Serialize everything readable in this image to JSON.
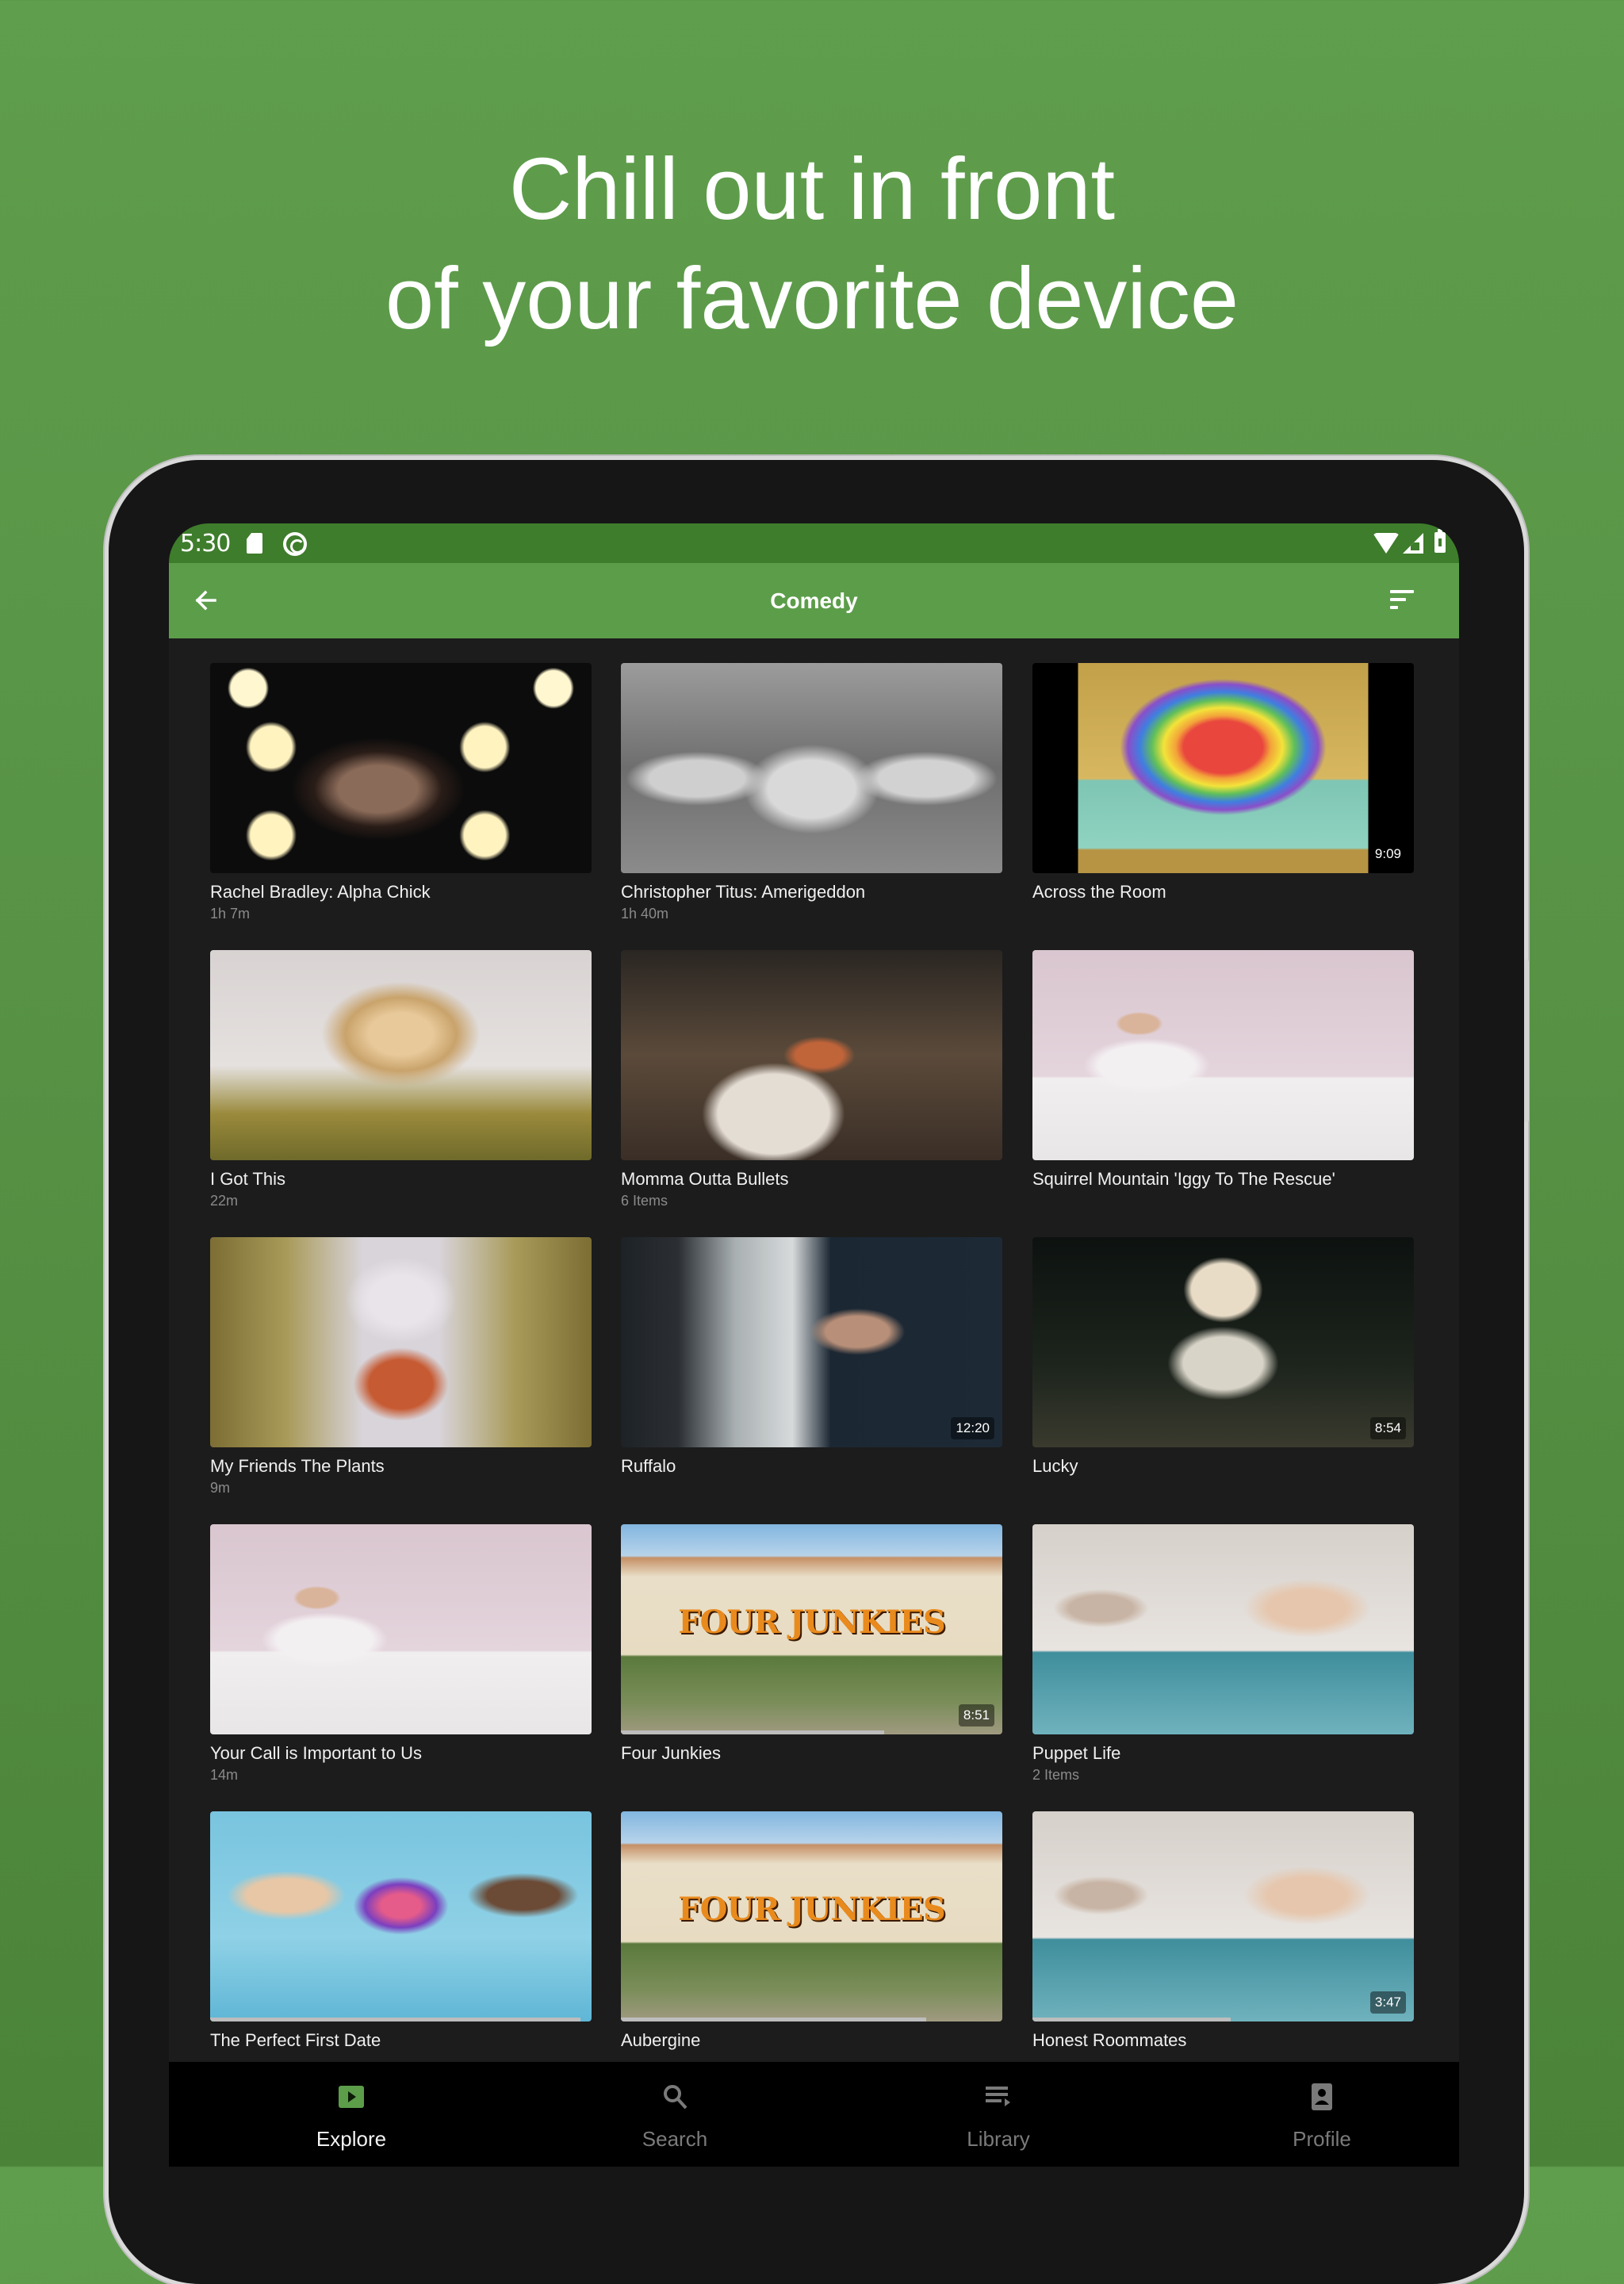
{
  "headline": {
    "line1": "Chill out in front",
    "line2": "of your favorite device"
  },
  "colors": {
    "brand_green": "#5c9d4a",
    "status_green": "#3e7d2b",
    "background": "#1c1c1c"
  },
  "statusbar": {
    "time": "5:30",
    "icons": [
      "sd-card-icon",
      "sync-icon",
      "wifi-icon",
      "signal-icon",
      "battery-charging-icon"
    ]
  },
  "appbar": {
    "back_icon": "arrow-back-icon",
    "title": "Comedy",
    "sort_icon": "sort-icon"
  },
  "items": [
    {
      "title": "Rachel Bradley: Alpha Chick",
      "subtitle": "1h 7m",
      "duration": "",
      "progress": null,
      "thumb": "stage-lights"
    },
    {
      "title": "Christopher Titus: Amerigeddon",
      "subtitle": "1h 40m",
      "duration": "",
      "progress": null,
      "thumb": "bw-couch"
    },
    {
      "title": "Across the Room",
      "subtitle": "",
      "duration": "9:09",
      "progress": null,
      "thumb": "rainbow-poster"
    },
    {
      "title": "I Got This",
      "subtitle": "22m",
      "duration": "",
      "progress": null,
      "thumb": "blonde-woman"
    },
    {
      "title": "Momma Outta Bullets",
      "subtitle": "6 Items",
      "duration": "",
      "progress": null,
      "thumb": "night-cafe"
    },
    {
      "title": "Squirrel Mountain 'Iggy To The Rescue'",
      "subtitle": "",
      "duration": "",
      "progress": null,
      "thumb": "office-cheer"
    },
    {
      "title": "My Friends The Plants",
      "subtitle": "9m",
      "duration": "",
      "progress": null,
      "thumb": "plants-room"
    },
    {
      "title": "Ruffalo",
      "subtitle": "",
      "duration": "12:20",
      "progress": null,
      "thumb": "doorway-man"
    },
    {
      "title": "Lucky",
      "subtitle": "",
      "duration": "8:54",
      "progress": null,
      "thumb": "night-table"
    },
    {
      "title": "Your Call is Important to Us",
      "subtitle": "14m",
      "duration": "",
      "progress": null,
      "thumb": "office-cheer"
    },
    {
      "title": "Four Junkies",
      "subtitle": "",
      "duration": "8:51",
      "progress": 0.69,
      "thumb": "house-four-junkies"
    },
    {
      "title": "Puppet Life",
      "subtitle": "2 Items",
      "duration": "",
      "progress": null,
      "thumb": "kitchen-couple"
    },
    {
      "title": "The Perfect First Date",
      "subtitle": "",
      "duration": "",
      "progress": 0.97,
      "thumb": "perfect-date-poster"
    },
    {
      "title": "Aubergine",
      "subtitle": "",
      "duration": "",
      "progress": 0.8,
      "thumb": "house-four-junkies"
    },
    {
      "title": "Honest Roommates",
      "subtitle": "",
      "duration": "3:47",
      "progress": 0.52,
      "thumb": "kitchen-couple"
    }
  ],
  "bottom_nav": [
    {
      "label": "Explore",
      "icon": "explore-play-icon",
      "active": true
    },
    {
      "label": "Search",
      "icon": "search-icon",
      "active": false
    },
    {
      "label": "Library",
      "icon": "library-queue-icon",
      "active": false
    },
    {
      "label": "Profile",
      "icon": "profile-badge-icon",
      "active": false
    }
  ]
}
